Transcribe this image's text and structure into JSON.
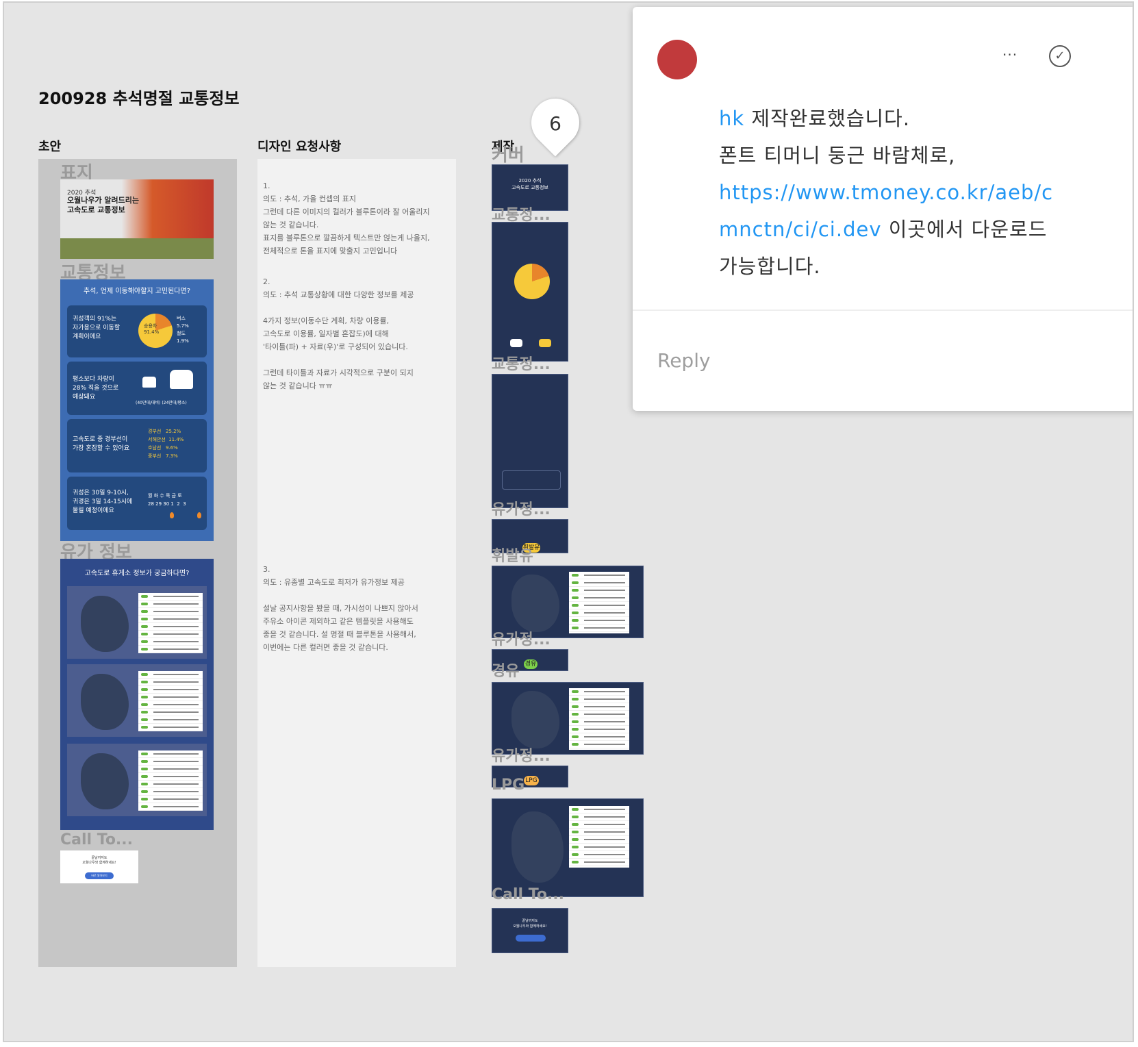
{
  "page": {
    "title": "200928 추석명절 교통정보"
  },
  "columns": {
    "draft": "초안",
    "requests": "디자인 요청사항",
    "production": "제작"
  },
  "draft_layers": [
    "표지",
    "교통정보",
    "유가 정보",
    "Call To..."
  ],
  "cover": {
    "year": "2020 추석",
    "headline": "오월나우가 알려드리는\n고속도로 교통정보"
  },
  "traffic_cards": {
    "header": "추석, 언제 이동해야할지 고민된다면?",
    "card1_text": "귀성객의 91%는\n자가용으로 이동할\n계획이에요",
    "card1_pie": "승용차\n91.4%",
    "card1_side": "버스\n5.7%\n철도\n1.9%",
    "card2_text": "평소보다 차량이\n28% 적을 것으로\n예상돼요",
    "card2_labels": "(40만대/대비)   (24만대/평소)",
    "card3_text": "고속도로 중 경부선이\n가장 혼잡할 수 있어요",
    "card3_list": "경부선   25.2%\n서해안선  11.4%\n호남선   9.6%\n중부선   7.3%",
    "card4_text": "귀성은 30일 9-10시,\n귀경은 3일 14-15시에\n몰릴 예정이에요",
    "card4_days": "월 화 수 목 금 토\n28 29 30 1  2  3"
  },
  "fuel": {
    "header": "고속도로 휴게소 정보가 궁금하다면?"
  },
  "cta": {
    "text": "끝날까지도\n오월나우와 함께하세요!",
    "button": "바로 알아보기"
  },
  "requests": [
    "1.\n의도 : 추석, 가을 컨셉의 표지\n그런데 다른 이미지의 컬러가 블루톤이라 잘 어울리지\n않는 것 같습니다.\n표지를 블루톤으로 깔끔하게 텍스트만 얹는게 나을지,\n전체적으로 톤을 표지에 맞출지 고민입니다",
    "2.\n의도 : 추석 교통상황에 대한 다양한 정보를 제공\n\n4가지 정보(이동수단 계획, 차량 이용률,\n고속도로 이용률, 일자별 혼잡도)에 대해\n'타이틀(파) + 자료(우)'로 구성되어 있습니다.\n\n그런데 타이틀과 자료가 시각적으로 구분이 되지\n않는 것 같습니다 ㅠㅠ",
    "3.\n의도 : 유종별 고속도로 최저가 유가정보 제공\n\n설날 공지사항을 봤을 때, 가시성이 나쁘지 않아서\n주유소 아이콘 제외하고 같은 템플릿을 사용해도\n좋을 것 같습니다. 설 명절 때 블루톤을 사용해서,\n이번에는 다른 컬러면 좋을 것 같습니다."
  ],
  "production_layers": [
    "커버",
    "교통정...",
    "교통정...",
    "유가정...",
    "휘발유",
    "유가정...",
    "경유",
    "유가정...",
    "LPG",
    "Call To..."
  ],
  "production_thumbs": {
    "cover_title": "2020 추석\n고속도로 교통정보",
    "pill_gasoline": "휘발유",
    "pill_diesel": "경유",
    "pill_lpg": "LPG",
    "cta_text": "끝날까지도\n오월나우와 함께하세요!"
  },
  "comment_pin": {
    "number": "6"
  },
  "comment": {
    "mention": "hk",
    "line1": " 제작완료했습니다.",
    "line2": "폰트 티머니 둥근 바람체로,",
    "link": "https://www.tmoney.co.kr/aeb/cmnctn/ci/ci.dev",
    "line3": " 이곳에서 다운로드 가능합니다.",
    "more": "···",
    "resolve": "✓",
    "reply_placeholder": "Reply"
  },
  "colors": {
    "avatar": "#c13a3c",
    "link": "#2196f3",
    "navy": "#243355",
    "blue": "#23497e"
  }
}
